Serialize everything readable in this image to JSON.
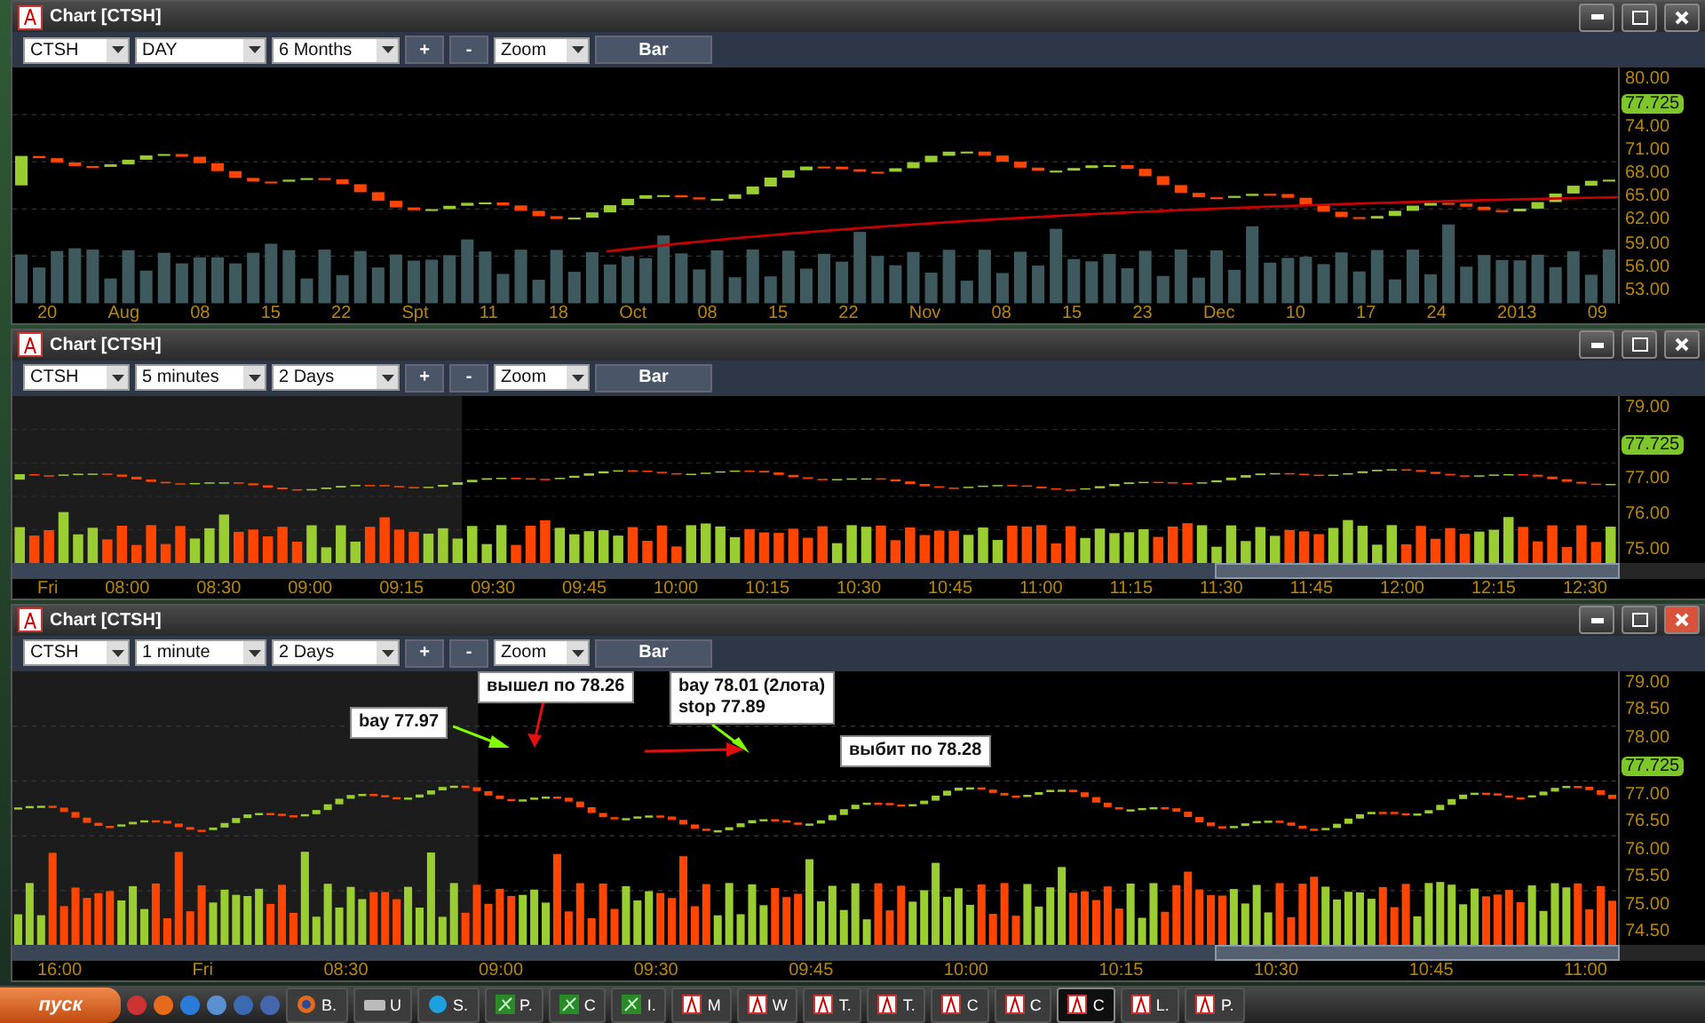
{
  "windows": [
    {
      "title": "Chart [CTSH]",
      "active": false,
      "symbol": "CTSH",
      "interval": "DAY",
      "range": "6 Months",
      "plus": "+",
      "minus": "-",
      "zoom": "Zoom",
      "bar_button": "Bar",
      "scrollbar": false,
      "premarket": false,
      "price_axis": [
        {
          "text": "80.00",
          "kind": "tick"
        },
        {
          "text": "77.725",
          "kind": "last"
        },
        {
          "text": "74.00",
          "kind": "tick"
        },
        {
          "text": "71.00",
          "kind": "tick"
        },
        {
          "text": "68.00",
          "kind": "tick"
        },
        {
          "text": "65.00",
          "kind": "tick"
        },
        {
          "text": "62.00",
          "kind": "tick"
        },
        {
          "text": "59.00",
          "kind": "tick"
        },
        {
          "text": "56.00",
          "kind": "tick"
        },
        {
          "text": "53.00",
          "kind": "tick"
        }
      ],
      "time_axis": [
        "20",
        "Aug",
        "08",
        "15",
        "22",
        "Spt",
        "11",
        "18",
        "Oct",
        "08",
        "15",
        "22",
        "Nov",
        "08",
        "15",
        "23",
        "Dec",
        "10",
        "17",
        "24",
        "2013",
        "09"
      ]
    },
    {
      "title": "Chart [CTSH]",
      "active": false,
      "symbol": "CTSH",
      "interval": "5 minutes",
      "range": "2 Days",
      "plus": "+",
      "minus": "-",
      "zoom": "Zoom",
      "bar_button": "Bar",
      "scrollbar": true,
      "premarket": true,
      "price_axis": [
        {
          "text": "79.00",
          "kind": "tick"
        },
        {
          "text": "77.725",
          "kind": "last"
        },
        {
          "text": "77.00",
          "kind": "tick"
        },
        {
          "text": "76.00",
          "kind": "tick"
        },
        {
          "text": "75.00",
          "kind": "tick"
        }
      ],
      "time_axis": [
        "Fri",
        "08:00",
        "08:30",
        "09:00",
        "09:15",
        "09:30",
        "09:45",
        "10:00",
        "10:15",
        "10:30",
        "10:45",
        "11:00",
        "11:15",
        "11:30",
        "11:45",
        "12:00",
        "12:15",
        "12:30"
      ]
    },
    {
      "title": "Chart [CTSH]",
      "active": true,
      "symbol": "CTSH",
      "interval": "1 minute",
      "range": "2 Days",
      "plus": "+",
      "minus": "-",
      "zoom": "Zoom",
      "bar_button": "Bar",
      "scrollbar": true,
      "premarket": true,
      "price_axis": [
        {
          "text": "79.00",
          "kind": "tick"
        },
        {
          "text": "78.50",
          "kind": "tick"
        },
        {
          "text": "78.00",
          "kind": "tick"
        },
        {
          "text": "77.725",
          "kind": "last"
        },
        {
          "text": "77.00",
          "kind": "tick"
        },
        {
          "text": "76.50",
          "kind": "tick"
        },
        {
          "text": "76.00",
          "kind": "tick"
        },
        {
          "text": "75.50",
          "kind": "tick"
        },
        {
          "text": "75.00",
          "kind": "tick"
        },
        {
          "text": "74.50",
          "kind": "tick"
        }
      ],
      "time_axis": [
        "16:00",
        "Fri",
        "08:30",
        "09:00",
        "09:30",
        "09:45",
        "10:00",
        "10:15",
        "10:30",
        "10:45",
        "11:00"
      ],
      "annotations": [
        {
          "lines": [
            "вышел по 78.26"
          ],
          "color": "#e01010"
        },
        {
          "lines": [
            "bay 77.97"
          ],
          "color": "#7fff00"
        },
        {
          "lines": [
            "bay 78.01 (2лота)",
            "stop 77.89"
          ],
          "color": "#7fff00"
        },
        {
          "lines": [
            "выбит по 78.28"
          ],
          "color": "#e01010"
        }
      ]
    }
  ],
  "taskbar": {
    "start": "пуск",
    "tasks": [
      {
        "label": "B.",
        "kind": "firefox",
        "selected": false
      },
      {
        "label": "U",
        "kind": "drive",
        "selected": false
      },
      {
        "label": "S.",
        "kind": "skype",
        "selected": false
      },
      {
        "label": "P.",
        "kind": "leaf",
        "selected": false
      },
      {
        "label": "C",
        "kind": "leaf",
        "selected": false
      },
      {
        "label": "I.",
        "kind": "leaf",
        "selected": false
      },
      {
        "label": "M",
        "kind": "chart",
        "selected": false
      },
      {
        "label": "W",
        "kind": "chart",
        "selected": false
      },
      {
        "label": "T.",
        "kind": "chart",
        "selected": false
      },
      {
        "label": "T.",
        "kind": "chart",
        "selected": false
      },
      {
        "label": "C",
        "kind": "chart",
        "selected": false
      },
      {
        "label": "C",
        "kind": "chart",
        "selected": false
      },
      {
        "label": "C",
        "kind": "chart",
        "selected": true
      },
      {
        "label": "L.",
        "kind": "chart",
        "selected": false
      },
      {
        "label": "P.",
        "kind": "chart",
        "selected": false
      }
    ]
  }
}
